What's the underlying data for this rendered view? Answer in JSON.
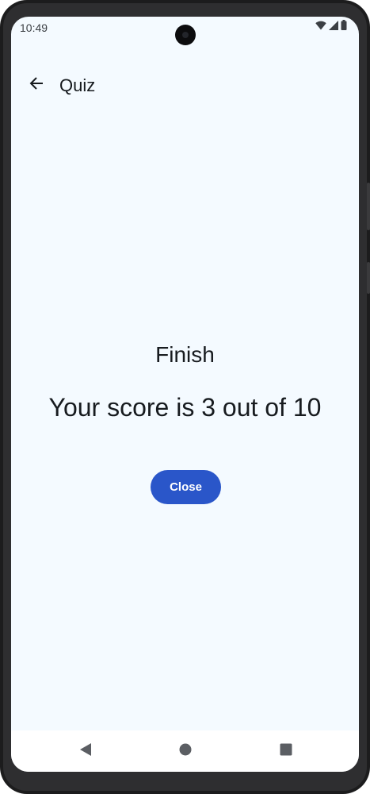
{
  "status_bar": {
    "time": "10:49",
    "icons": [
      "wifi-icon",
      "cellular-signal-icon",
      "battery-icon"
    ]
  },
  "app_bar": {
    "back_icon": "arrow-back-icon",
    "title": "Quiz"
  },
  "result": {
    "heading": "Finish",
    "score_text": "Your score is 3 out of 10"
  },
  "actions": {
    "close_label": "Close"
  },
  "nav_bar": {
    "buttons": [
      "nav-back-icon",
      "nav-home-icon",
      "nav-recents-icon"
    ]
  },
  "colors": {
    "background": "#f4faff",
    "primary_button": "#2a56c9",
    "text": "#171b1f",
    "device_frame": "#1c1c1d"
  }
}
